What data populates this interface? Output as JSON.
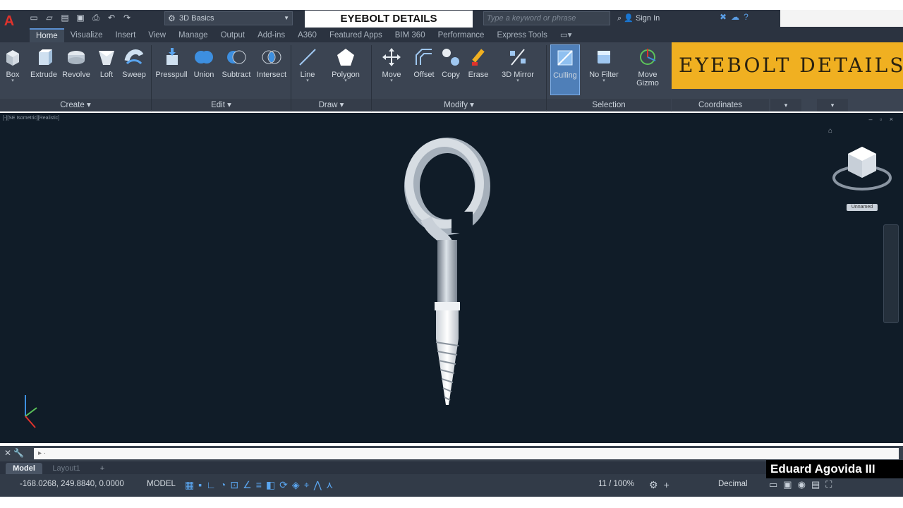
{
  "window": {
    "app_logo": "A",
    "workspace": "3D Basics",
    "doc_title": "EYEBOLT DETAILS",
    "search_placeholder": "Type a keyword or phrase",
    "sign_in": "Sign In"
  },
  "ribbon_tabs": [
    "Home",
    "Visualize",
    "Insert",
    "View",
    "Manage",
    "Output",
    "Add-ins",
    "A360",
    "Featured Apps",
    "BIM 360",
    "Performance",
    "Express Tools"
  ],
  "ribbon_tools": {
    "box": "Box",
    "extrude": "Extrude",
    "revolve": "Revolve",
    "loft": "Loft",
    "sweep": "Sweep",
    "presspull": "Presspull",
    "union": "Union",
    "subtract": "Subtract",
    "intersect": "Intersect",
    "line": "Line",
    "polygon": "Polygon",
    "move": "Move",
    "offset": "Offset",
    "copy": "Copy",
    "erase": "Erase",
    "mirror3d": "3D Mirror",
    "culling": "Culling",
    "no_filter": "No Filter",
    "move_gizmo_1": "Move",
    "move_gizmo_2": "Gizmo"
  },
  "panels": {
    "create": "Create ▾",
    "edit": "Edit ▾",
    "draw": "Draw ▾",
    "modify": "Modify ▾",
    "selection": "Selection",
    "coordinates": "Coordinates"
  },
  "banner": "EYEBOLT DETAILS",
  "viewport": {
    "label": "[-][SE Isometric][Realistic]",
    "unnamed": "Unnamed"
  },
  "layout_tabs": {
    "model": "Model",
    "layout1": "Layout1",
    "plus": "+"
  },
  "status": {
    "coords": "-168.0268, 249.8840, 0.0000",
    "model": "MODEL",
    "scale": "11 / 100%",
    "units": "Decimal"
  },
  "credit": "Eduard Agovida III",
  "colors": {
    "ribbon": "#3b4452",
    "viewport": "#101c28",
    "banner": "#f0b021",
    "accent": "#5b8fd0"
  }
}
